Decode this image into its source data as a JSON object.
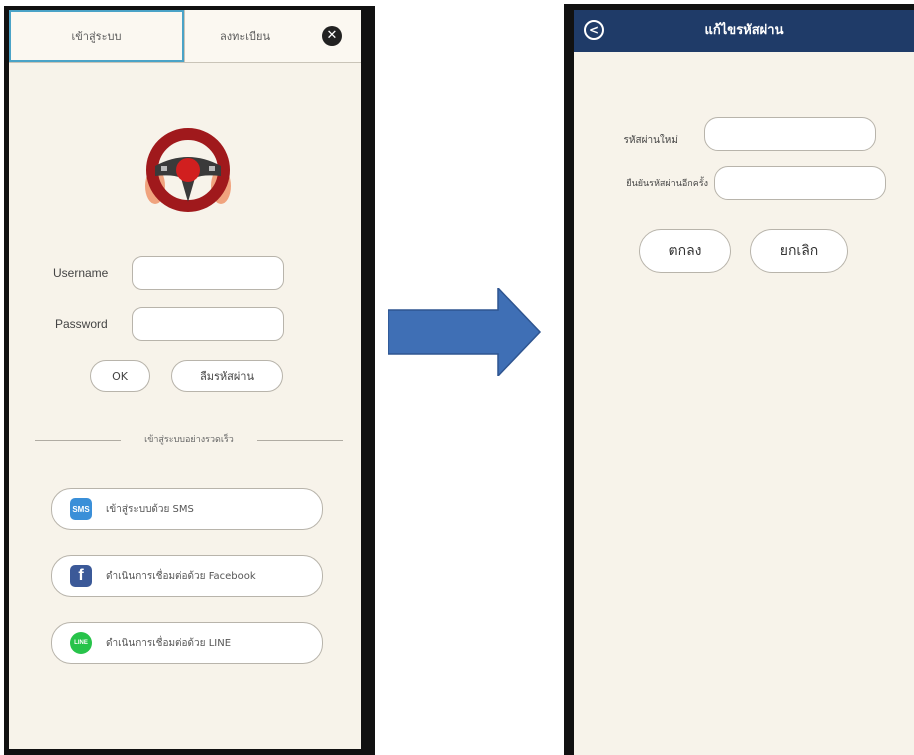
{
  "login": {
    "tabs": [
      {
        "label": "เข้าสู่ระบบ",
        "active": true
      },
      {
        "label": "ลงทะเบียน",
        "active": false
      }
    ],
    "close_icon": "close-icon",
    "close_glyph": "✕",
    "username_label": "Username",
    "password_label": "Password",
    "ok_label": "OK",
    "forgot_label": "ลืมรหัสผ่าน",
    "divider_text": "เข้าสู่ระบบอย่างรวดเร็ว",
    "social": [
      {
        "icon": "sms-icon",
        "icon_text": "SMS",
        "color": "#3a8fd8",
        "label": "เข้าสู่ระบบด้วย SMS"
      },
      {
        "icon": "facebook-icon",
        "icon_text": "f",
        "color": "#3b5998",
        "label": "ดำเนินการเชื่อมต่อด้วย Facebook"
      },
      {
        "icon": "line-icon",
        "icon_text": "LINE",
        "color": "#27c34a",
        "label": "ดำเนินการเชื่อมต่อด้วย LINE"
      }
    ]
  },
  "change_password": {
    "back_glyph": "<",
    "title": "แก้ไขรหัสผ่าน",
    "new_password_label": "รหัสผ่านใหม่",
    "confirm_password_label": "ยืนยันรหัสผ่านอีกครั้ง",
    "confirm_button": "ตกลง",
    "cancel_button": "ยกเลิก"
  },
  "colors": {
    "header": "#1f3b68",
    "background": "#f7f3ea",
    "arrow": "#3f6fb5",
    "tab_accent": "#4aa3c7"
  }
}
